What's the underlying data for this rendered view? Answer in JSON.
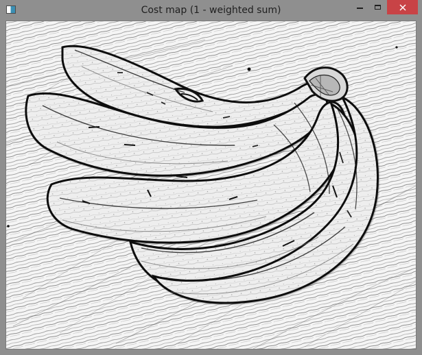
{
  "window": {
    "title": "Cost map (1 - weighted sum)"
  },
  "controls": {
    "minimize_icon": "minimize-icon",
    "maximize_icon": "maximize-icon",
    "close_icon": "close-icon"
  },
  "colors": {
    "titlebar": "#8f8f8f",
    "close_button": "#c84346",
    "image_background": "#f4f4f4",
    "edge_lines": "#111111"
  },
  "image": {
    "content": "banana-edge-cost-map"
  }
}
